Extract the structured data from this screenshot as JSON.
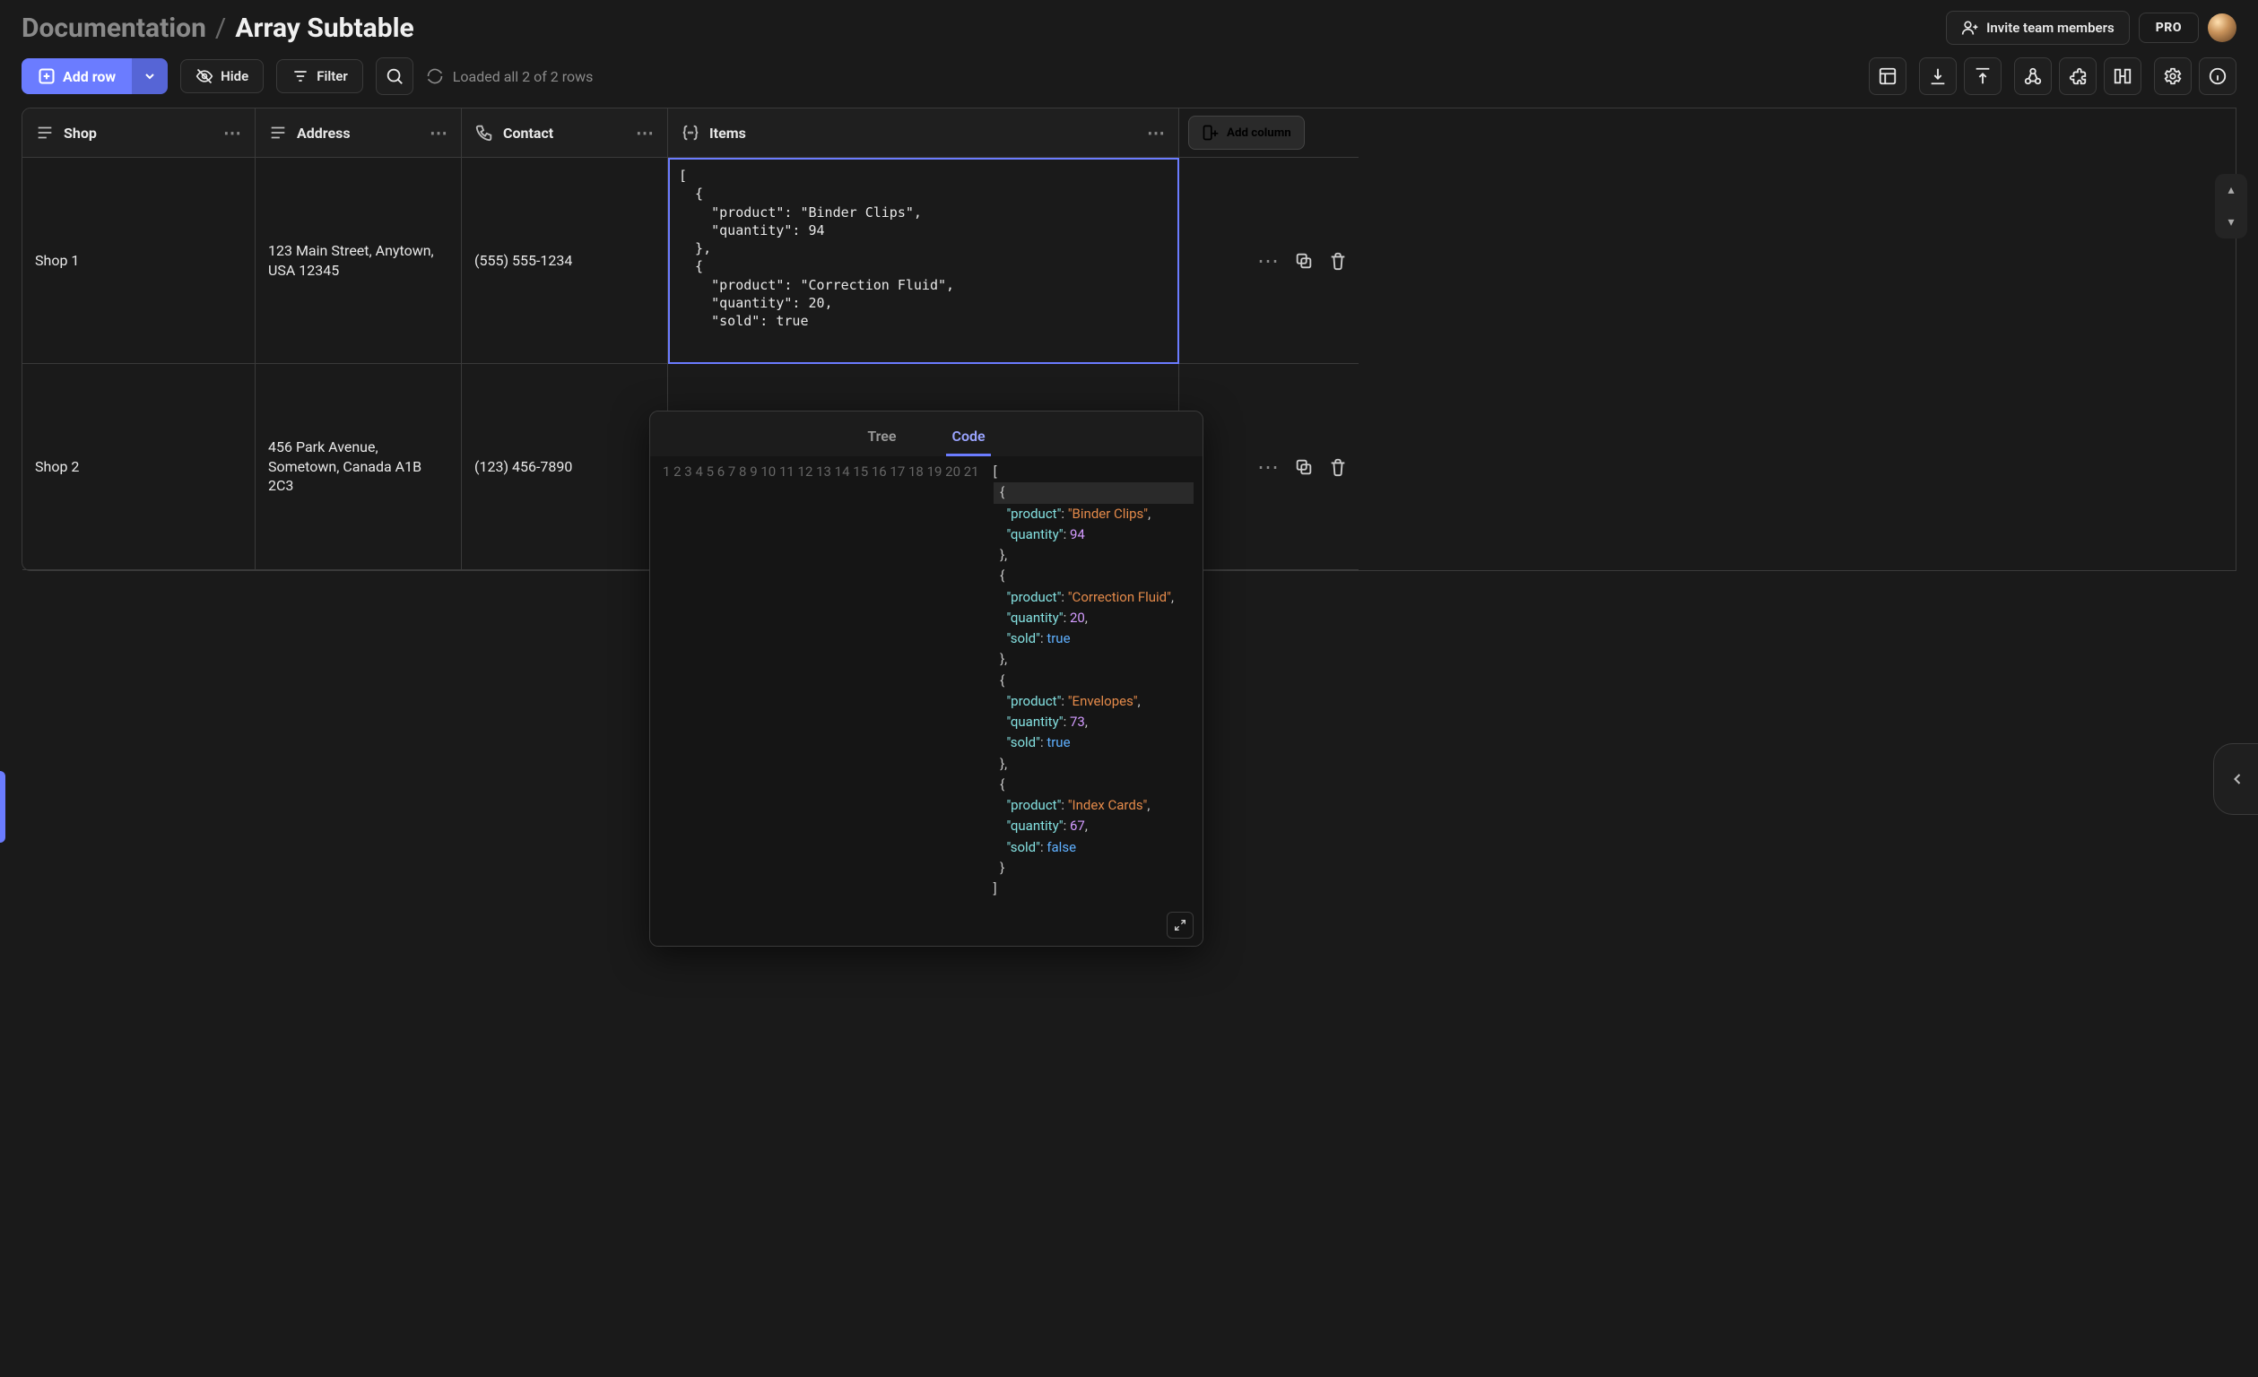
{
  "breadcrumb": {
    "root": "Documentation",
    "leaf": "Array Subtable"
  },
  "header": {
    "invite_label": "Invite team members",
    "pro_label": "PRO"
  },
  "toolbar": {
    "add_row_label": "Add row",
    "hide_label": "Hide",
    "filter_label": "Filter",
    "status_label": "Loaded all 2 of 2 rows"
  },
  "columns": {
    "shop": "Shop",
    "address": "Address",
    "contact": "Contact",
    "items": "Items",
    "add_column_label": "Add column"
  },
  "rows": [
    {
      "shop": "Shop 1",
      "address": "123 Main Street, Anytown, USA 12345",
      "contact": "(555) 555-1234",
      "items_preview": "[\n  {\n    \"product\": \"Binder Clips\",\n    \"quantity\": 94\n  },\n  {\n    \"product\": \"Correction Fluid\",\n    \"quantity\": 20,\n    \"sold\": true"
    },
    {
      "shop": "Shop 2",
      "address": "456 Park Avenue, Sometown, Canada A1B 2C3",
      "contact": "(123) 456-7890",
      "items_preview": ""
    }
  ],
  "editor": {
    "tab_tree": "Tree",
    "tab_code": "Code"
  },
  "chart_data": {
    "type": "table",
    "title": "Items (row 1) JSON array",
    "columns": [
      "product",
      "quantity",
      "sold"
    ],
    "rows": [
      {
        "product": "Binder Clips",
        "quantity": 94
      },
      {
        "product": "Correction Fluid",
        "quantity": 20,
        "sold": true
      },
      {
        "product": "Envelopes",
        "quantity": 73,
        "sold": true
      },
      {
        "product": "Index Cards",
        "quantity": 67,
        "sold": false
      }
    ]
  }
}
